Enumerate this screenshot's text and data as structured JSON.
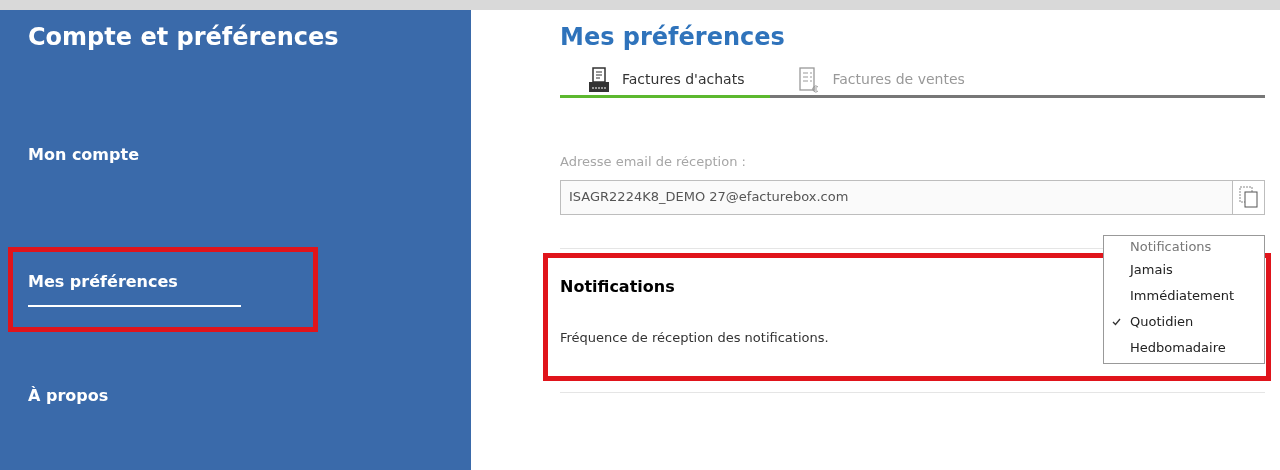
{
  "sidebar": {
    "title": "Compte et préférences",
    "items": [
      {
        "label": "Mon compte",
        "selected": false,
        "highlighted": false
      },
      {
        "label": "Mes préférences",
        "selected": true,
        "highlighted": true
      },
      {
        "label": "À propos",
        "selected": false,
        "highlighted": false
      }
    ]
  },
  "main": {
    "title": "Mes préférences",
    "tabs": [
      {
        "label": "Factures d'achats",
        "selected": true,
        "kind": "purchase"
      },
      {
        "label": "Factures de ventes",
        "selected": false,
        "kind": "sales"
      }
    ],
    "email": {
      "label": "Adresse email de réception :",
      "value": "ISAGR2224K8_DEMO 27@efacturebox.com"
    },
    "notifications": {
      "heading": "Notifications",
      "description": "Fréquence de réception des notifications.",
      "highlighted": true,
      "dropdown": {
        "header": "Notifications",
        "options": [
          {
            "label": "Jamais",
            "selected": false
          },
          {
            "label": "Immédiatement",
            "selected": false
          },
          {
            "label": "Quotidien",
            "selected": true
          },
          {
            "label": "Hedbomadaire",
            "selected": false
          }
        ]
      }
    }
  }
}
